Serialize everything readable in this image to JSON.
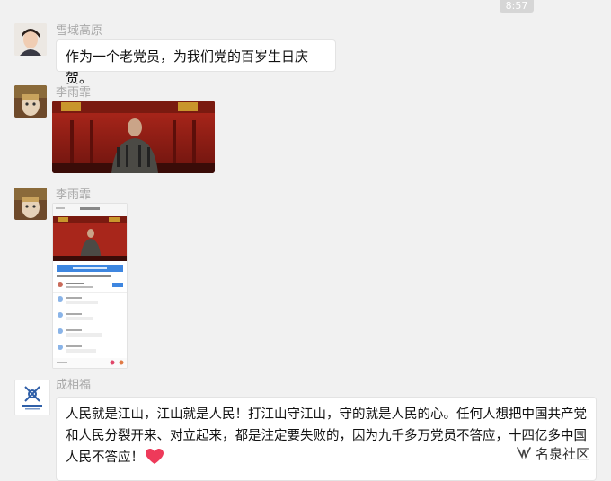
{
  "time": "8:57",
  "messages": [
    {
      "sender": "雪域高原",
      "text": "作为一个老党员，为我们党的百岁生日庆贺。"
    },
    {
      "sender": "李雨霏"
    },
    {
      "sender": "李雨霏"
    },
    {
      "sender": "成相福",
      "text": "人民就是江山，江山就是人民！打江山守江山，守的就是人民的心。任何人想把中国共产党和人民分裂开来、对立起来，都是注定要失败的，因为九千多万党员不答应，十四亿多中国人民不答应！"
    }
  ],
  "watermark": "名泉社区",
  "colors": {
    "bg": "#f1f1f1",
    "bubble": "#ffffff",
    "name": "#a9a9a9",
    "heart": "#ee3a5a"
  },
  "icons": {
    "heart": "heart-emoji-icon",
    "watermark": "wechat-channel-icon"
  }
}
